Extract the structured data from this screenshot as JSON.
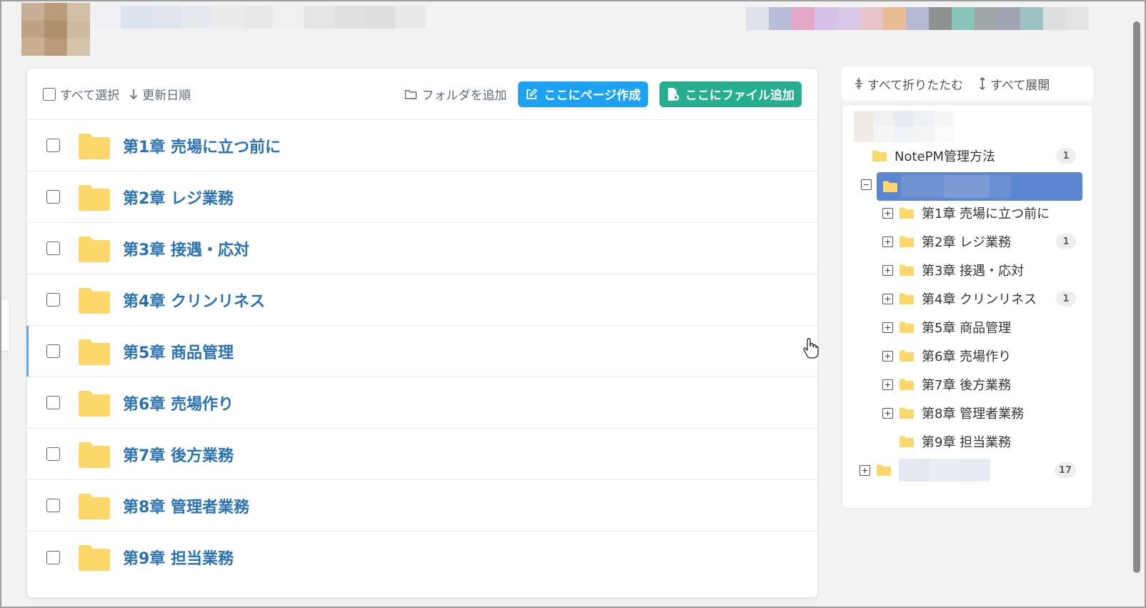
{
  "toolbar": {
    "select_all": "すべて選択",
    "sort": "更新日順",
    "add_folder": "フォルダを追加",
    "create_page": "ここにページ作成",
    "add_file": "ここにファイル追加"
  },
  "folders": [
    {
      "label": "第1章 売場に立つ前に"
    },
    {
      "label": "第2章 レジ業務"
    },
    {
      "label": "第3章 接遇・応対"
    },
    {
      "label": "第4章 クリンリネス"
    },
    {
      "label": "第5章 商品管理"
    },
    {
      "label": "第6章 売場作り"
    },
    {
      "label": "第7章 後方業務"
    },
    {
      "label": "第8章 管理者業務"
    },
    {
      "label": "第9章 担当業務"
    }
  ],
  "tree_header": {
    "collapse_all": "すべて折りたたむ",
    "expand_all": "すべて展開"
  },
  "tree": {
    "notepm": {
      "label": "NotePM管理方法",
      "count": "1"
    },
    "children": [
      {
        "label": "第1章 売場に立つ前に",
        "count": ""
      },
      {
        "label": "第2章 レジ業務",
        "count": "1"
      },
      {
        "label": "第3章 接遇・応対",
        "count": ""
      },
      {
        "label": "第4章 クリンリネス",
        "count": "1"
      },
      {
        "label": "第5章 商品管理",
        "count": ""
      },
      {
        "label": "第6章 売場作り",
        "count": ""
      },
      {
        "label": "第7章 後方業務",
        "count": ""
      },
      {
        "label": "第8章 管理者業務",
        "count": ""
      },
      {
        "label": "第9章 担当業務",
        "count": ""
      }
    ],
    "last_count": "17"
  },
  "colors": {
    "accent_blue": "#1da1f2",
    "accent_green": "#27ae8f",
    "folder_yellow": "#fdd76a",
    "link_blue": "#2b72b3",
    "selected_tree": "#5b86d1"
  }
}
